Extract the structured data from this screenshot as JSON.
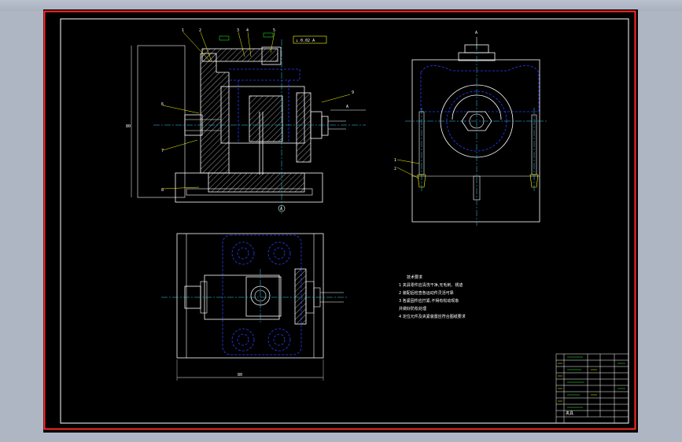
{
  "app": {
    "background_color": "#aeb6c4",
    "drawing_background": "#000000",
    "border_color": "#ff2a2a"
  },
  "colors": {
    "outline": "#ffffff",
    "hidden_lines": "#2a3cff",
    "centerline": "#2fd3ff",
    "callout": "#ffff00",
    "hatch": "#ffffff",
    "accent_green": "#27ff27",
    "magenta": "#ff35ff"
  },
  "front_view": {
    "section_label": "A",
    "datum_label": "A",
    "tolerance_label": "⊥ 0.02 A",
    "callouts": [
      "1",
      "2",
      "3",
      "4",
      "5",
      "6",
      "7",
      "8",
      "9"
    ],
    "dimension_height": "80"
  },
  "side_view": {
    "view_label": "A",
    "callouts": [
      "1",
      "2"
    ]
  },
  "top_view": {
    "dimension_width": "80"
  },
  "technical_notes": {
    "title": "技术要求",
    "lines": [
      "1 夹具零件应清洗干净,无毛刺、锈迹",
      "2 装配后检查各运动件灵活可靠",
      "3 各紧固件应拧紧,不得有松动现象",
      "  并做好防松处理",
      "4 定位元件及夹紧装置应符合图纸要求"
    ]
  },
  "title_block": {
    "name": "夹具"
  }
}
